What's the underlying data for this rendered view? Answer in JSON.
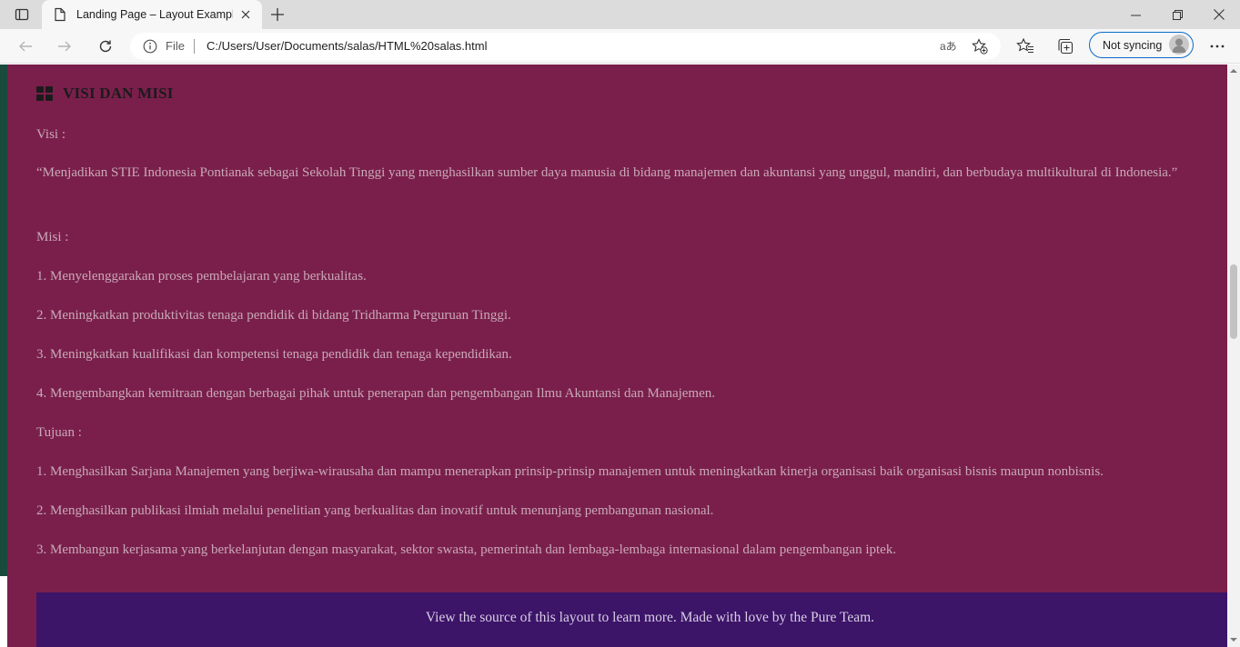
{
  "browser": {
    "tab": {
      "title": "Landing Page – Layout Examples"
    },
    "address": {
      "scheme": "File",
      "url": "C:/Users/User/Documents/salas/HTML%20salas.html",
      "read_aloud": "aあ"
    },
    "profile": {
      "label": "Not syncing"
    },
    "icons": [
      "tab-actions-icon",
      "page-icon",
      "close-icon",
      "plus-icon",
      "minimize-icon",
      "restore-icon",
      "close-window-icon",
      "back-icon",
      "forward-icon",
      "refresh-icon",
      "info-icon",
      "add-favorite-icon",
      "favorites-icon",
      "collections-icon",
      "avatar-icon",
      "more-icon"
    ]
  },
  "page": {
    "heading": "VISI DAN MISI",
    "visi_label": "Visi :",
    "visi_text": "“Menjadikan STIE Indonesia Pontianak sebagai Sekolah Tinggi yang menghasilkan sumber daya manusia di bidang manajemen dan akuntansi yang unggul, mandiri, dan berbudaya multikultural di Indonesia.”",
    "misi_label": "Misi :",
    "misi": [
      "1. Menyelenggarakan proses pembelajaran yang berkualitas.",
      "2. Meningkatkan produktivitas tenaga pendidik di bidang Tridharma Perguruan Tinggi.",
      "3. Meningkatkan kualifikasi dan kompetensi tenaga pendidik dan tenaga kependidikan.",
      "4. Mengembangkan kemitraan dengan berbagai pihak untuk penerapan dan pengembangan Ilmu Akuntansi dan Manajemen."
    ],
    "tujuan_label": "Tujuan :",
    "tujuan": [
      "1. Menghasilkan Sarjana Manajemen yang berjiwa-wirausaha dan mampu menerapkan prinsip-prinsip manajemen untuk meningkatkan kinerja organisasi baik organisasi bisnis maupun nonbisnis.",
      "2. Menghasilkan publikasi ilmiah melalui penelitian yang berkualitas dan inovatif untuk menunjang pembangunan nasional.",
      "3. Membangun kerjasama yang berkelanjutan dengan masyarakat, sektor swasta, pemerintah dan lembaga-lembaga internasional dalam pengembangan iptek."
    ],
    "footer": "View the source of this layout to learn more. Made with love by the Pure Team."
  },
  "colors": {
    "content_bg": "#7a1f4b",
    "footer_bg": "#3c1468",
    "text": "#c9a9b8",
    "side_strip": "#1a4a3c",
    "sync_border": "#0b6bcb"
  }
}
